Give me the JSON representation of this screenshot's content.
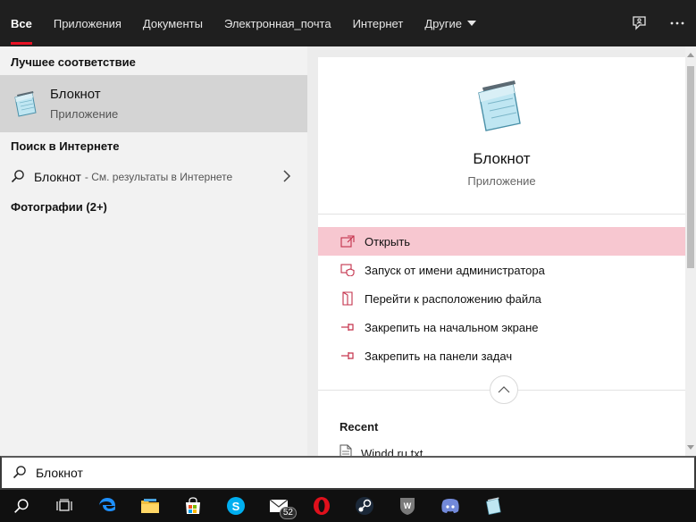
{
  "nav": {
    "tabs": [
      {
        "label": "Все",
        "active": true
      },
      {
        "label": "Приложения"
      },
      {
        "label": "Документы"
      },
      {
        "label": "Электронная_почта"
      },
      {
        "label": "Интернет"
      },
      {
        "label": "Другие"
      }
    ],
    "feedback_icon": "feedback-icon",
    "more_icon": "ellipsis-icon"
  },
  "left": {
    "best_match_header": "Лучшее соответствие",
    "best_match": {
      "title": "Блокнот",
      "subtitle": "Приложение",
      "icon": "notepad-icon"
    },
    "web_header": "Поиск в Интернете",
    "web_result": {
      "main": "Блокнот",
      "sub": "- См. результаты в Интернете"
    },
    "photos_header": "Фотографии (2+)"
  },
  "right": {
    "title": "Блокнот",
    "subtitle": "Приложение",
    "actions": [
      {
        "label": "Открыть",
        "icon": "open-icon",
        "highlighted": true
      },
      {
        "label": "Запуск от имени администратора",
        "icon": "run-as-admin-icon"
      },
      {
        "label": "Перейти к расположению файла",
        "icon": "file-location-icon"
      },
      {
        "label": "Закрепить на начальном экране",
        "icon": "pin-icon"
      },
      {
        "label": "Закрепить на панели задач",
        "icon": "pin-icon"
      }
    ],
    "recent_header": "Recent",
    "recent_files": [
      {
        "name": "Windd.ru.txt",
        "icon": "text-file-icon"
      }
    ]
  },
  "search": {
    "value": "Блокнот"
  },
  "taskbar": {
    "items": [
      "search-icon",
      "task-view-icon",
      "edge-icon",
      "file-explorer-icon",
      "store-icon",
      "skype-icon",
      "mail-icon",
      "opera-icon",
      "steam-icon",
      "world-of-tanks-icon",
      "discord-icon",
      "notepad-icon"
    ],
    "mail_badge": "52"
  },
  "colors": {
    "accent": "#e81123",
    "highlight": "#f7c7d0",
    "action_icon": "#c4314b"
  }
}
